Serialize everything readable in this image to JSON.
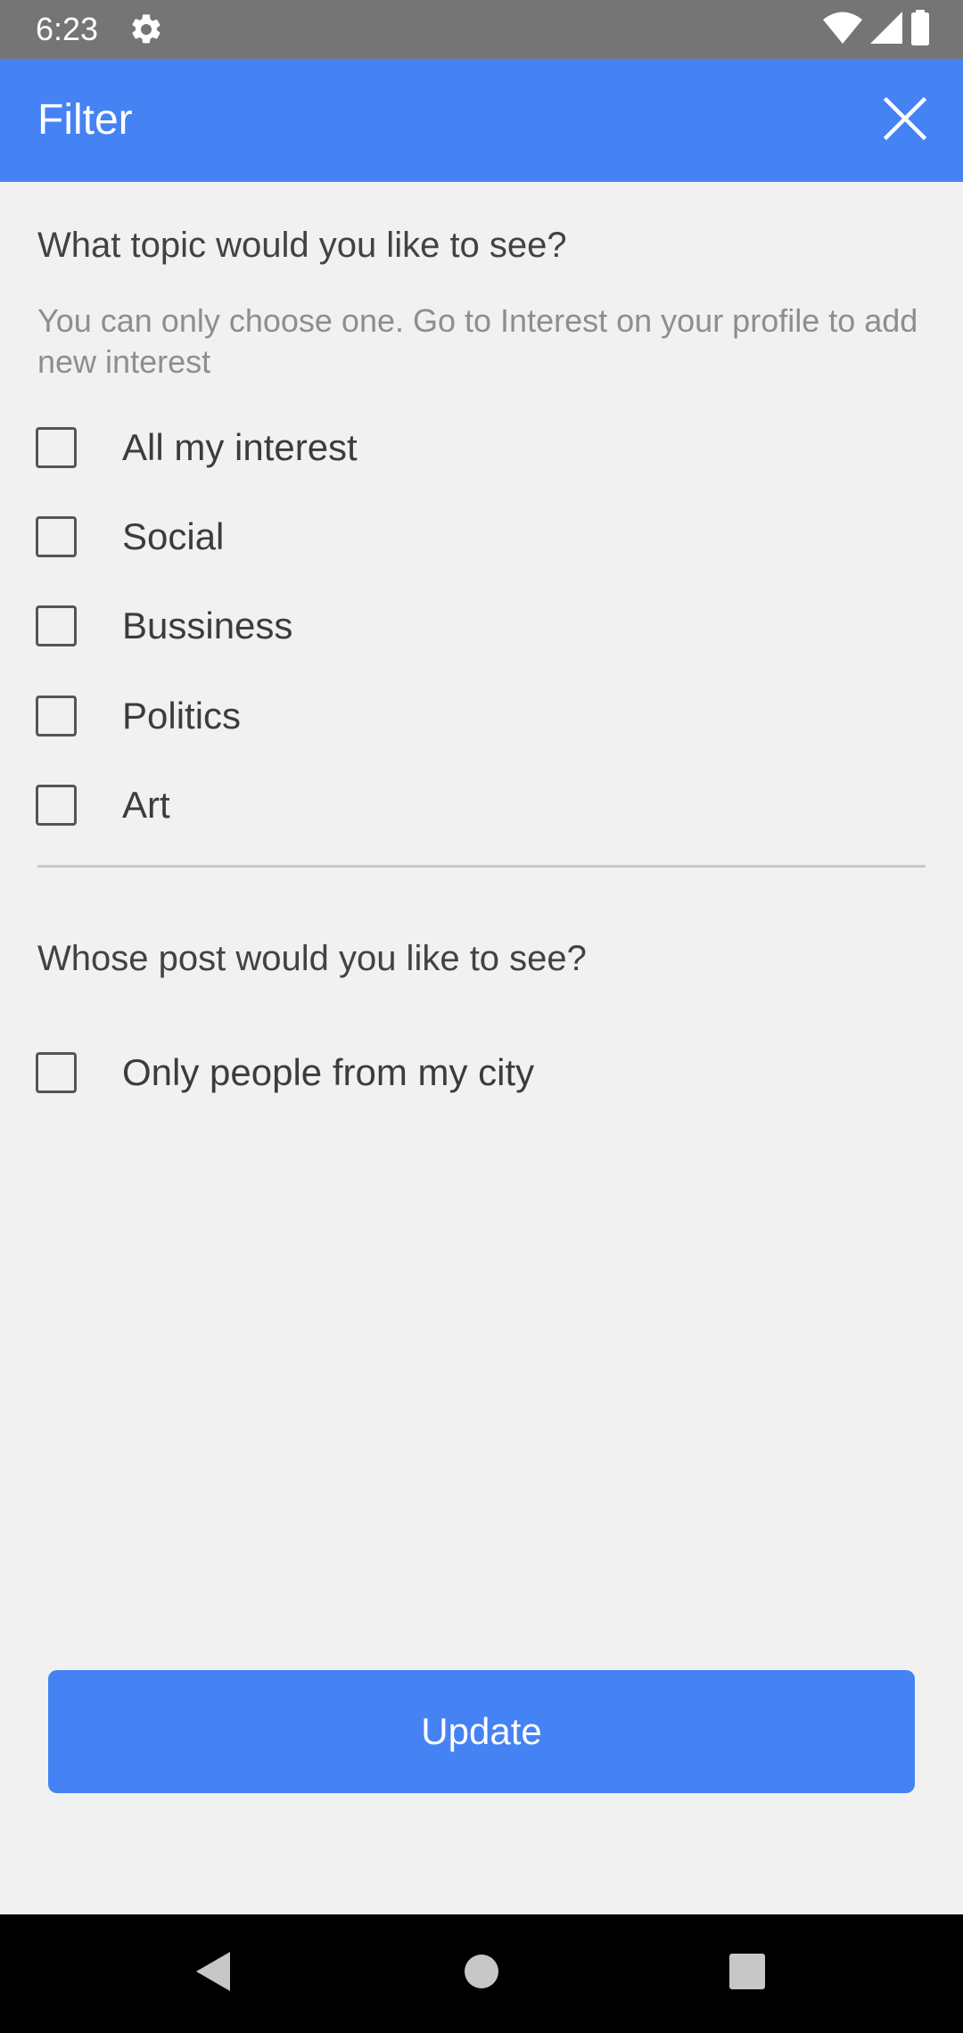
{
  "status_bar": {
    "time": "6:23",
    "icons": [
      "gear-icon",
      "wifi-icon",
      "signal-icon",
      "battery-icon"
    ]
  },
  "app_bar": {
    "title": "Filter",
    "close_icon": "close-icon",
    "color": "#4582f4"
  },
  "topic_section": {
    "title": "What topic would you like to see?",
    "hint": "You can only choose one. Go to Interest on your profile to add new interest",
    "options": [
      {
        "label": "All my interest",
        "checked": false
      },
      {
        "label": "Social",
        "checked": false
      },
      {
        "label": "Bussiness",
        "checked": false
      },
      {
        "label": "Politics",
        "checked": false
      },
      {
        "label": "Art",
        "checked": false
      }
    ]
  },
  "people_section": {
    "title": "Whose post would you like to see?",
    "options": [
      {
        "label": "Only people from my city",
        "checked": false
      }
    ]
  },
  "update_button": {
    "label": "Update"
  },
  "nav_bar": {
    "icons": [
      "back-icon",
      "home-icon",
      "recents-icon"
    ]
  }
}
